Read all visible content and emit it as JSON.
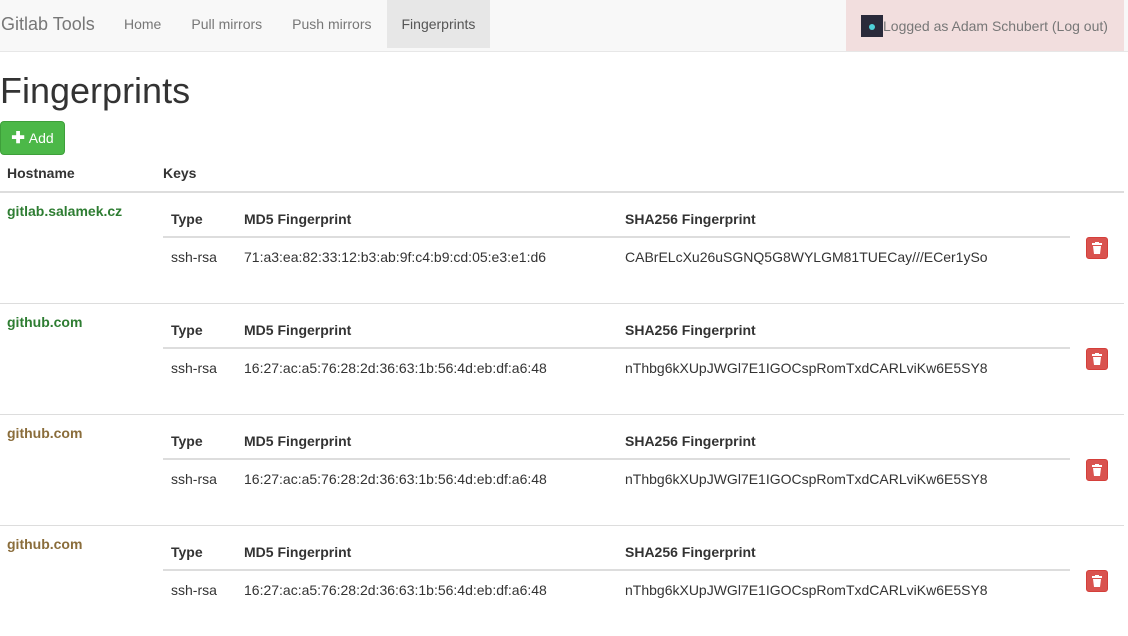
{
  "navbar": {
    "brand": "Gitlab Tools",
    "items": [
      {
        "label": "Home",
        "active": false
      },
      {
        "label": "Pull mirrors",
        "active": false
      },
      {
        "label": "Push mirrors",
        "active": false
      },
      {
        "label": "Fingerprints",
        "active": true
      }
    ],
    "user_text": "Logged as Adam Schubert (Log out)"
  },
  "page": {
    "title": "Fingerprints",
    "add_label": "Add"
  },
  "table": {
    "col_hostname": "Hostname",
    "col_keys": "Keys",
    "inner_cols": {
      "type": "Type",
      "md5": "MD5 Fingerprint",
      "sha256": "SHA256 Fingerprint"
    },
    "rows": [
      {
        "hostname": "gitlab.salamek.cz",
        "host_color": "#2e7d32",
        "type": "ssh-rsa",
        "md5": "71:a3:ea:82:33:12:b3:ab:9f:c4:b9:cd:05:e3:e1:d6",
        "sha256": "CABrELcXu26uSGNQ5G8WYLGM81TUECay///ECer1ySo"
      },
      {
        "hostname": "github.com",
        "host_color": "#2e7d32",
        "type": "ssh-rsa",
        "md5": "16:27:ac:a5:76:28:2d:36:63:1b:56:4d:eb:df:a6:48",
        "sha256": "nThbg6kXUpJWGl7E1IGOCspRomTxdCARLviKw6E5SY8"
      },
      {
        "hostname": "github.com",
        "host_color": "#8a6d3b",
        "type": "ssh-rsa",
        "md5": "16:27:ac:a5:76:28:2d:36:63:1b:56:4d:eb:df:a6:48",
        "sha256": "nThbg6kXUpJWGl7E1IGOCspRomTxdCARLviKw6E5SY8"
      },
      {
        "hostname": "github.com",
        "host_color": "#8a6d3b",
        "type": "ssh-rsa",
        "md5": "16:27:ac:a5:76:28:2d:36:63:1b:56:4d:eb:df:a6:48",
        "sha256": "nThbg6kXUpJWGl7E1IGOCspRomTxdCARLviKw6E5SY8"
      }
    ]
  },
  "icons": {
    "add": "plus-icon",
    "delete": "trash-icon",
    "avatar": "avatar-image"
  }
}
